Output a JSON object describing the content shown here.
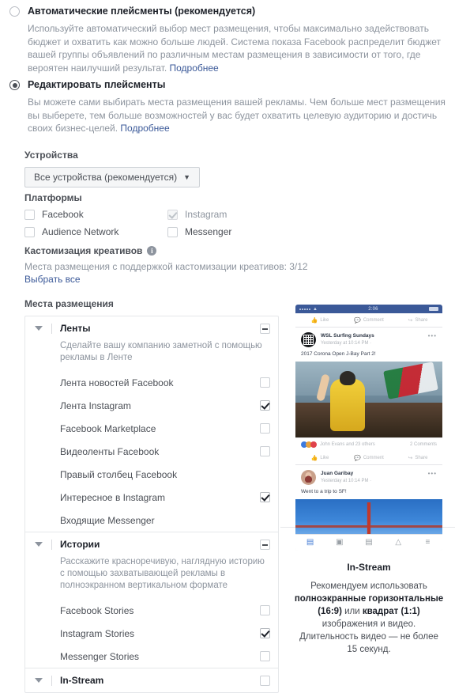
{
  "automatic": {
    "title": "Автоматические плейсменты (рекомендуется)",
    "desc": "Используйте автоматический выбор мест размещения, чтобы максимально задействовать бюджет и охватить как можно больше людей. Система показа Facebook распределит бюджет вашей группы объявлений по различным местам размещения в зависимости от того, где вероятен наилучший результат.",
    "learn_more": "Подробнее",
    "selected": false
  },
  "edit": {
    "title": "Редактировать плейсменты",
    "desc_part1": "Вы можете сами выбирать места размещения вашей рекламы. Чем больше мест размещения вы выберете, тем больше возможностей у вас будет охватить целевую аудиторию и достичь своих бизнес-целей.",
    "learn_more": "Подробнее",
    "selected": true
  },
  "devices": {
    "label": "Устройства",
    "selected_value": "Все устройства (рекомендуется)",
    "caret_icon": "chevron-down-icon"
  },
  "platforms": {
    "label": "Платформы",
    "items": [
      {
        "label": "Facebook",
        "checked": false,
        "disabled": false
      },
      {
        "label": "Instagram",
        "checked": true,
        "disabled": true
      },
      {
        "label": "Audience Network",
        "checked": false,
        "disabled": false
      },
      {
        "label": "Messenger",
        "checked": false,
        "disabled": false
      }
    ]
  },
  "creative_customization": {
    "title": "Кастомизация креативов",
    "info_icon": "info-icon",
    "subtitle": "Места размещения с поддержкой кастомизации креативов: 3/12",
    "select_all": "Выбрать все"
  },
  "placements": {
    "label": "Места размещения",
    "groups": [
      {
        "title": "Ленты",
        "desc": "Сделайте вашу компанию заметной с помощью рекламы в Ленте",
        "state": "indeterminate",
        "expanded": true,
        "rows": [
          {
            "label": "Лента новостей Facebook",
            "checked": false,
            "hide_box": false
          },
          {
            "label": "Лента Instagram",
            "checked": true,
            "hide_box": false
          },
          {
            "label": "Facebook Marketplace",
            "checked": false,
            "hide_box": false
          },
          {
            "label": "Видеоленты Facebook",
            "checked": false,
            "hide_box": false
          },
          {
            "label": "Правый столбец Facebook",
            "checked": false,
            "hide_box": true
          },
          {
            "label": "Интересное в Instagram",
            "checked": true,
            "hide_box": false
          },
          {
            "label": "Входящие Messenger",
            "checked": false,
            "hide_box": true
          }
        ]
      },
      {
        "title": "Истории",
        "desc": "Расскажите красноречивую, наглядную историю с помощью захватывающей рекламы в полноэкранном вертикальном формате",
        "state": "indeterminate",
        "expanded": true,
        "rows": [
          {
            "label": "Facebook Stories",
            "checked": false,
            "hide_box": false
          },
          {
            "label": "Instagram Stories",
            "checked": true,
            "hide_box": false
          },
          {
            "label": "Messenger Stories",
            "checked": false,
            "hide_box": false
          }
        ]
      },
      {
        "title": "In-Stream",
        "desc": "",
        "state": "unchecked",
        "expanded": true,
        "rows": []
      }
    ]
  },
  "preview": {
    "title": "In-Stream",
    "desc_1": "Рекомендуем использовать ",
    "desc_b1": "полноэкранные горизонтальные (16:9)",
    "desc_2": " или ",
    "desc_b2": "квадрат (1:1)",
    "desc_3": " изображения и видео. Длительность видео — не более 15 секунд.",
    "phone": {
      "status_time": "2:06",
      "actions": [
        "Like",
        "Comment",
        "Share"
      ],
      "post1": {
        "name": "WSL Surfing Sundays",
        "time": "Yesterday at 10:14 PM ·",
        "text": "2017 Corona Open J-Bay Part 2!",
        "reactions_text": "John Evans and 23 others",
        "comments_text": "2 Comments"
      },
      "post2": {
        "name": "Juan Garibay",
        "time": "Yesterday at 10:14 PM ·",
        "text": "Went to a trip to SF!"
      },
      "nav_icons": [
        "feed-icon",
        "video-icon",
        "marketplace-icon",
        "notifications-icon",
        "menu-icon"
      ]
    }
  }
}
